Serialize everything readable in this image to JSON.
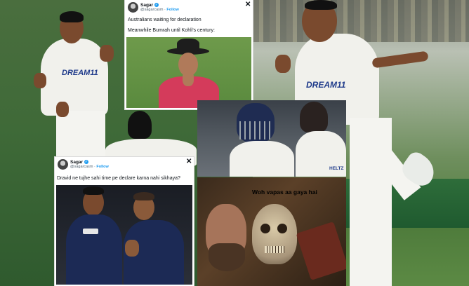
{
  "tweet1": {
    "name": "Sagar",
    "handle": "@sagarcasm",
    "follow": "Follow",
    "line1": "Australians waiting for declaration",
    "line2": "Meanwhile Bumrah until Kohli's century:",
    "close": "✕"
  },
  "tweet2": {
    "name": "Sagar",
    "handle": "@sagarcasm",
    "follow": "Follow",
    "text": "Dravid ne tujhe sahi time pe declare karna nahi sikhaya?",
    "close": "✕"
  },
  "meme": {
    "caption": "Woh vapas aa gaya hai"
  },
  "jersey": {
    "left_text": "DREAM11",
    "right_text": "DREAM11",
    "small_text": "HELTZ"
  },
  "colors": {
    "tweet_blue": "#1d9bf0",
    "umpire_shirt": "#d43b5b",
    "odi_kit": "#1c2a55"
  }
}
